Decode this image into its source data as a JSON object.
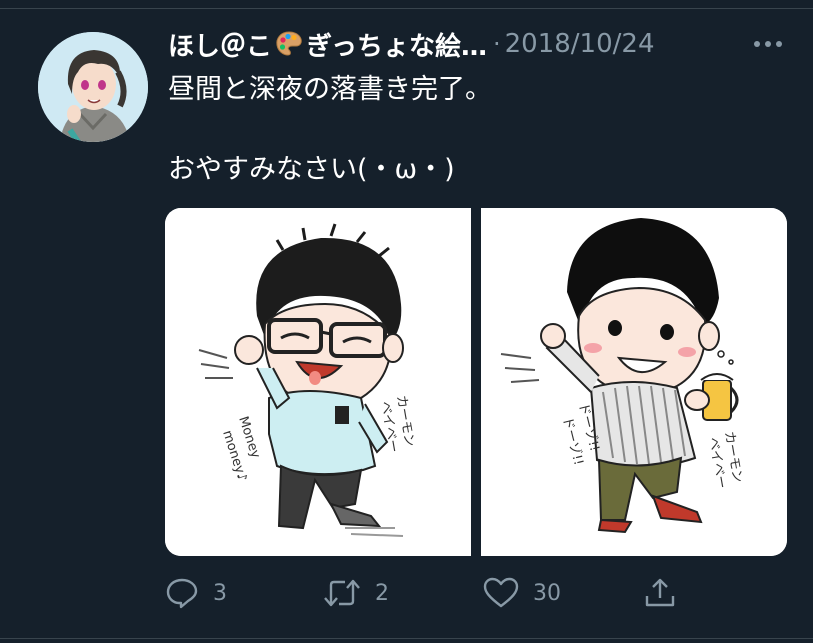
{
  "tweet": {
    "author": "ほし＠こ",
    "author_suffix": "ぎっちょな絵…",
    "separator": "·",
    "date": "2018/10/24",
    "text": "昼間と深夜の落書き完了。\n\nおやすみなさい(・ω・)"
  },
  "images": {
    "left": {
      "captions": [
        "カーモン",
        "ベイベー",
        "Money",
        "money♪"
      ]
    },
    "right": {
      "captions": [
        "カーモン",
        "ベイベー",
        "ドーゾ!!",
        "ドーゾ!!"
      ]
    }
  },
  "actions": {
    "reply_count": "3",
    "retweet_count": "2",
    "like_count": "30"
  },
  "icons": {
    "more": "more-icon",
    "reply": "reply-icon",
    "retweet": "retweet-icon",
    "like": "heart-icon",
    "share": "share-icon",
    "palette": "palette-emoji-icon"
  },
  "colors": {
    "background": "#15202b",
    "secondary_text": "#8899a6",
    "divider": "#38444d"
  }
}
